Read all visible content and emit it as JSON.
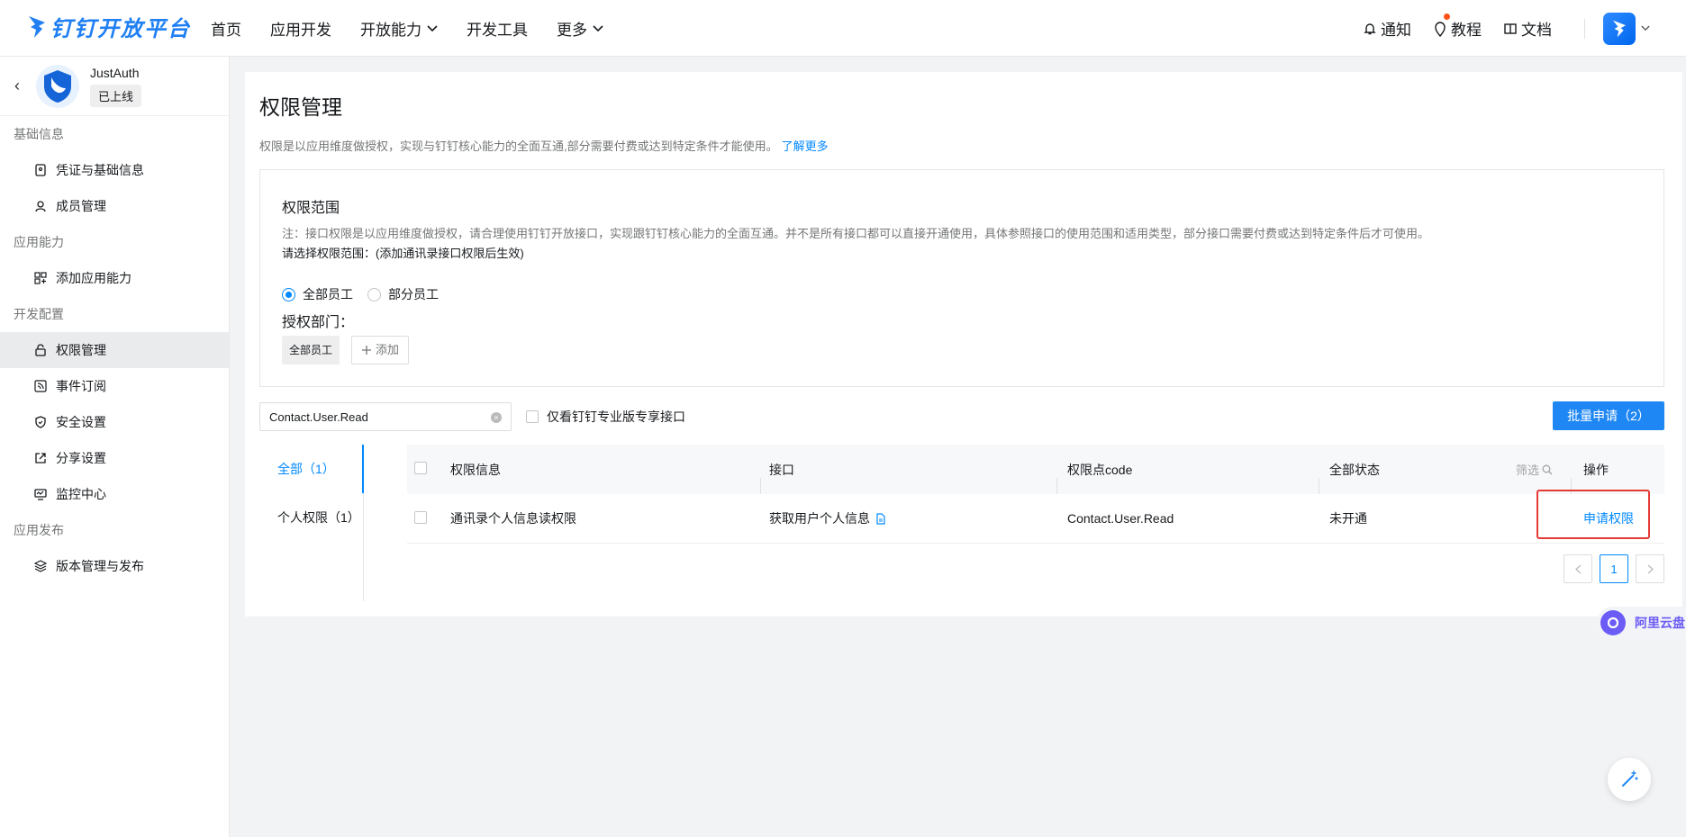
{
  "brand": {
    "name": "钉钉开放平台",
    "color": "#1f7ff3"
  },
  "nav": [
    {
      "label": "首页"
    },
    {
      "label": "应用开发"
    },
    {
      "label": "开放能力"
    },
    {
      "label": "开发工具"
    },
    {
      "label": "更多"
    }
  ],
  "top_right": {
    "notify": "通知",
    "tutorial": "教程",
    "docs": "文档"
  },
  "app": {
    "name": "JustAuth",
    "status": "已上线"
  },
  "sidebar": {
    "group_basic": "基础信息",
    "credentials": "凭证与基础信息",
    "members": "成员管理",
    "group_ability": "应用能力",
    "add_ability": "添加应用能力",
    "group_dev": "开发配置",
    "permission": "权限管理",
    "events": "事件订阅",
    "security": "安全设置",
    "share": "分享设置",
    "monitor": "监控中心",
    "group_publish": "应用发布",
    "versions": "版本管理与发布"
  },
  "main": {
    "title": "权限管理",
    "desc": "权限是以应用维度做授权，实现与钉钉核心能力的全面互通,部分需要付费或达到特定条件才能使用。",
    "learn_more": "了解更多",
    "scope": {
      "title": "权限范围",
      "note": "注：接口权限是以应用维度做授权，请合理使用钉钉开放接口，实现跟钉钉核心能力的全面互通。并不是所有接口都可以直接开通使用，具体参照接口的使用范围和适用类型，部分接口需要付费或达到特定条件后才可使用。",
      "select_label": "请选择权限范围：",
      "select_hint": "(添加通讯录接口权限后生效)",
      "radio_all": "全部员工",
      "radio_partial": "部分员工",
      "dept_label": "授权部门：",
      "dept_tag": "全部员工",
      "add_label": "添加"
    },
    "search_value": "Contact.User.Read",
    "pro_only": "仅看钉钉专业版专享接口",
    "batch_btn": "批量申请（2）",
    "tabs": {
      "all": "全部（1）",
      "personal": "个人权限（1）"
    },
    "table": {
      "headers": {
        "info": "权限信息",
        "api": "接口",
        "code": "权限点code",
        "status": "全部状态",
        "filter": "筛选",
        "action": "操作"
      },
      "rows": [
        {
          "info": "通讯录个人信息读权限",
          "api": "获取用户个人信息",
          "code": "Contact.User.Read",
          "status": "未开通",
          "action": "申请权限"
        }
      ]
    },
    "page": "1"
  },
  "aliyun_label": "阿里云盘"
}
